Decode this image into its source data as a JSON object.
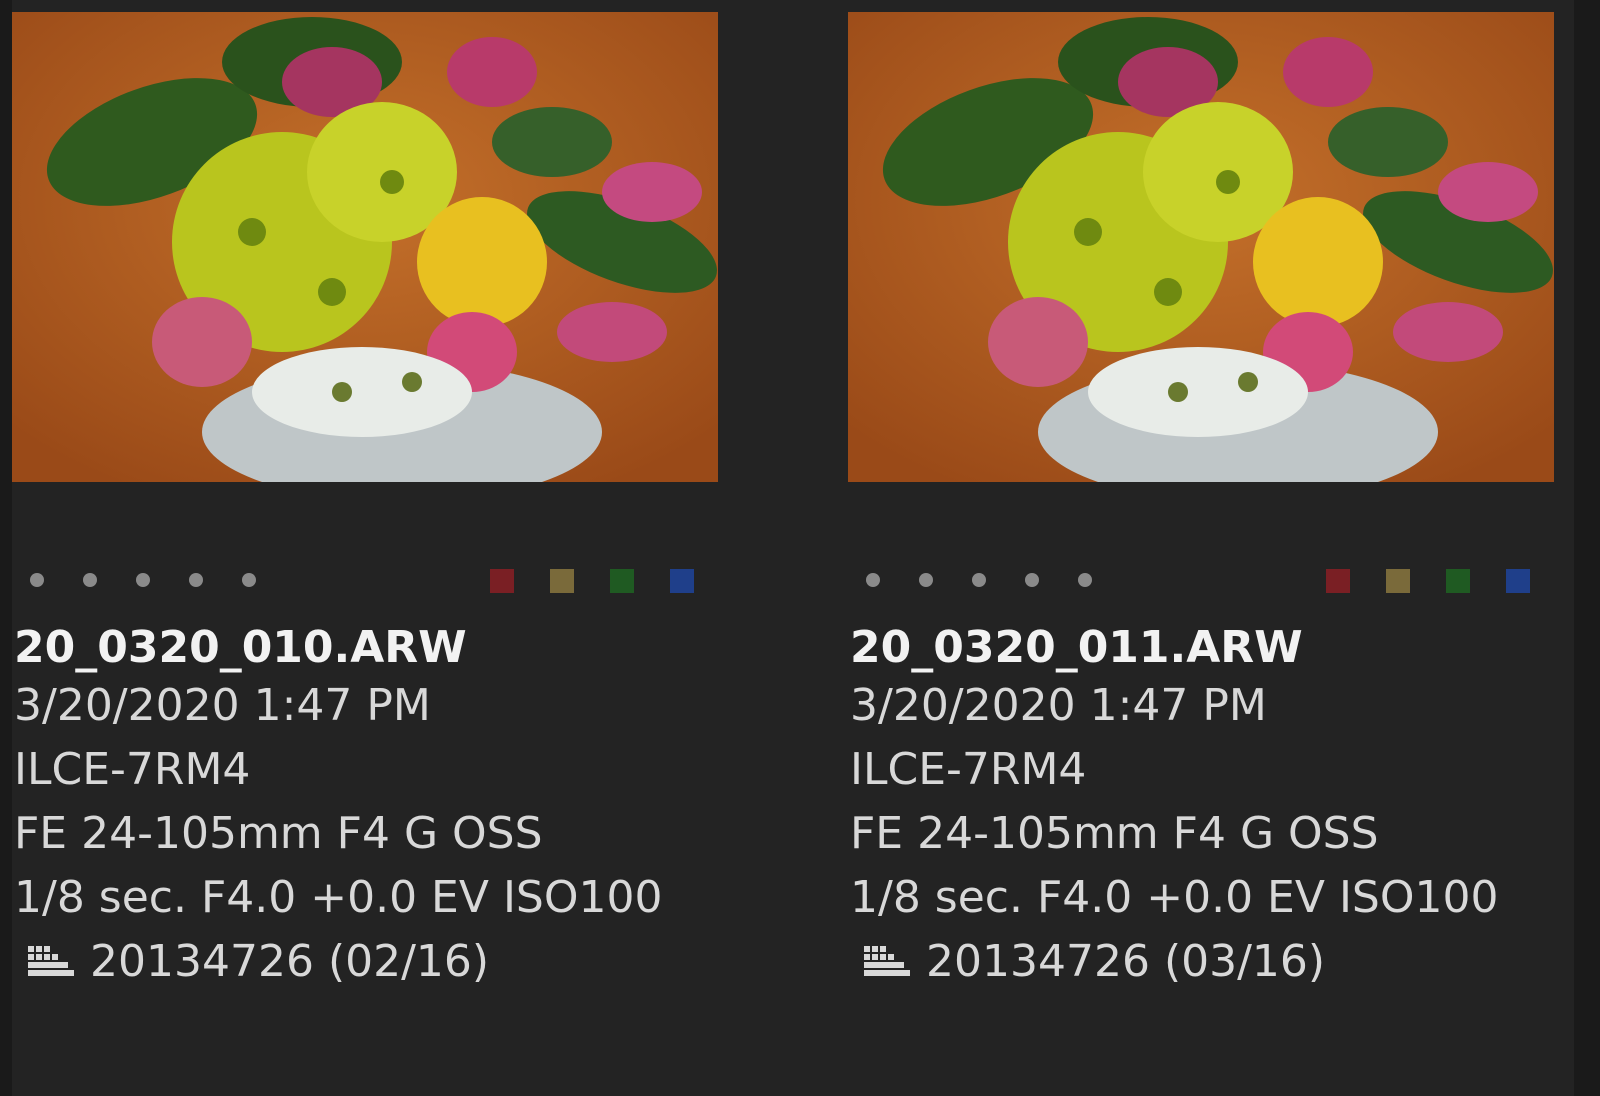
{
  "colors": {
    "background": "#232323",
    "star_dot": "#8a8a8a",
    "label_red": "#7a1f24",
    "label_yellow": "#7a6a3a",
    "label_green": "#1f5a22",
    "label_blue": "#1f3f8a"
  },
  "rating_count": 5,
  "color_labels": [
    "red",
    "yellow",
    "green",
    "blue"
  ],
  "photos": [
    {
      "filename": "20_0320_010.ARW",
      "datetime": "3/20/2020 1:47 PM",
      "camera": "ILCE-7RM4",
      "lens": "FE 24-105mm F4 G OSS",
      "exposure": "1/8 sec. F4.0 +0.0 EV ISO100",
      "group_icon": "burst-group-icon",
      "group": "20134726 (02/16)"
    },
    {
      "filename": "20_0320_011.ARW",
      "datetime": "3/20/2020 1:47 PM",
      "camera": "ILCE-7RM4",
      "lens": "FE 24-105mm F4 G OSS",
      "exposure": "1/8 sec. F4.0 +0.0 EV ISO100",
      "group_icon": "burst-group-icon",
      "group": "20134726 (03/16)"
    }
  ]
}
